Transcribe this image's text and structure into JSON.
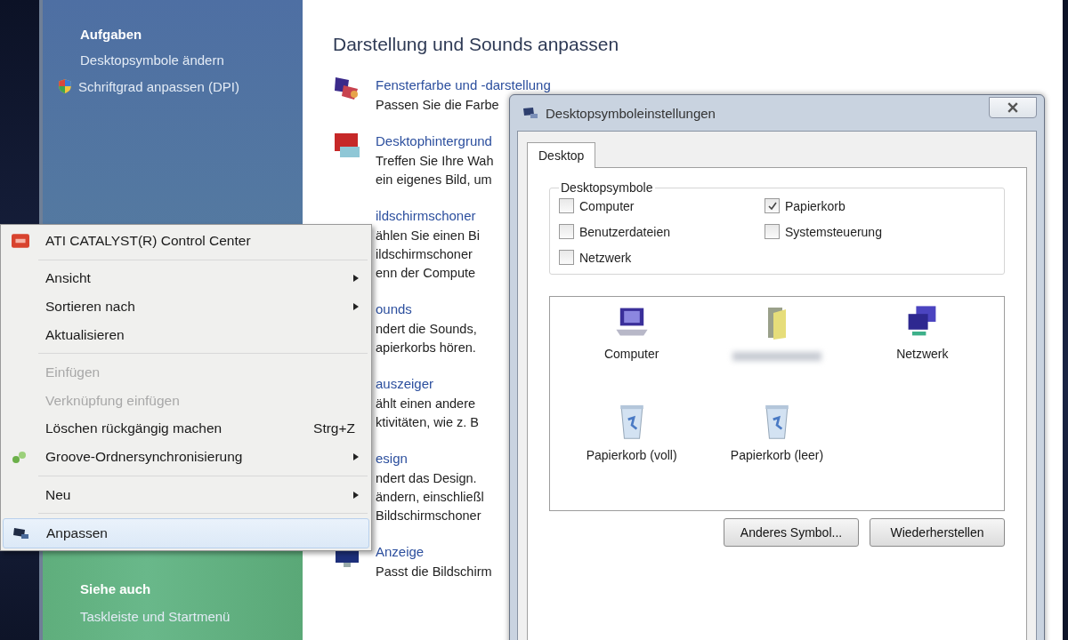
{
  "sidebar": {
    "heading": "Aufgaben",
    "links": [
      {
        "label": "Desktopsymbole ändern",
        "kind": "plain"
      },
      {
        "label": "Schriftgrad anpassen (DPI)",
        "kind": "shield"
      }
    ],
    "see_also": {
      "heading": "Siehe auch",
      "links": [
        "Taskleiste und Startmenü"
      ]
    }
  },
  "content": {
    "heading": "Darstellung und Sounds anpassen",
    "items": [
      {
        "kind": "iconed",
        "title": "Fensterfarbe und -darstellung",
        "lines": [
          "Passen Sie die Farbe"
        ]
      },
      {
        "kind": "iconed",
        "title": "Desktophintergrund",
        "lines": [
          "Treffen Sie Ihre Wah",
          "ein eigenes Bild, um"
        ]
      },
      {
        "kind": "covered",
        "title": "ildschirmschoner",
        "lines": [
          "ählen Sie einen Bi",
          "ildschirmschoner",
          "enn der Compute"
        ]
      },
      {
        "kind": "covered",
        "title": "ounds",
        "lines": [
          "ndert die Sounds,",
          "apierkorbs hören."
        ]
      },
      {
        "kind": "covered",
        "title": "auszeiger",
        "lines": [
          "ählt einen andere",
          "ktivitäten, wie z. B"
        ]
      },
      {
        "kind": "covered",
        "title": "esign",
        "lines": [
          "ndert das Design.",
          "ändern, einschließl",
          "Bildschirmschoner"
        ]
      },
      {
        "kind": "iconed",
        "title": "Anzeige",
        "lines": [
          "Passt die Bildschirm"
        ]
      }
    ]
  },
  "context_menu": {
    "items": [
      {
        "kind": "item",
        "label": "ATI CATALYST(R) Control Center",
        "disabled": false,
        "submenu": false,
        "selected": false
      },
      {
        "kind": "separator"
      },
      {
        "kind": "item",
        "label": "Ansicht",
        "disabled": false,
        "submenu": true,
        "selected": false
      },
      {
        "kind": "item",
        "label": "Sortieren nach",
        "disabled": false,
        "submenu": true,
        "selected": false
      },
      {
        "kind": "item",
        "label": "Aktualisieren",
        "disabled": false,
        "submenu": false,
        "selected": false
      },
      {
        "kind": "separator"
      },
      {
        "kind": "item",
        "label": "Einfügen",
        "disabled": true,
        "submenu": false,
        "selected": false
      },
      {
        "kind": "item",
        "label": "Verknüpfung einfügen",
        "disabled": true,
        "submenu": false,
        "selected": false
      },
      {
        "kind": "item",
        "label": "Löschen rückgängig machen",
        "shortcut": "Strg+Z",
        "disabled": false,
        "submenu": false,
        "selected": false
      },
      {
        "kind": "item",
        "label": "Groove-Ordnersynchronisierung",
        "disabled": false,
        "submenu": true,
        "selected": false
      },
      {
        "kind": "separator"
      },
      {
        "kind": "item",
        "label": "Neu",
        "disabled": false,
        "submenu": true,
        "selected": false
      },
      {
        "kind": "separator"
      },
      {
        "kind": "item",
        "label": "Anpassen",
        "disabled": false,
        "submenu": false,
        "selected": true
      }
    ]
  },
  "dialog": {
    "title": "Desktopsymboleinstellungen",
    "tabs": [
      {
        "label": "Desktop",
        "selected": true
      }
    ],
    "group": {
      "title": "Desktopsymbole",
      "checkboxes": [
        {
          "label": "Computer",
          "checked": false
        },
        {
          "label": "Papierkorb",
          "checked": true
        },
        {
          "label": "Benutzerdateien",
          "checked": false
        },
        {
          "label": "Systemsteuerung",
          "checked": false
        },
        {
          "label": "Netzwerk",
          "checked": false
        }
      ]
    },
    "icons": [
      {
        "label": "Computer",
        "blurred": false
      },
      {
        "blurred": true
      },
      {
        "label": "Netzwerk",
        "blurred": false
      },
      {
        "label": "Papierkorb (voll)",
        "blurred": false
      },
      {
        "label": "Papierkorb (leer)",
        "blurred": false
      }
    ],
    "buttons": [
      "Anderes Symbol...",
      "Wiederherstellen"
    ]
  }
}
